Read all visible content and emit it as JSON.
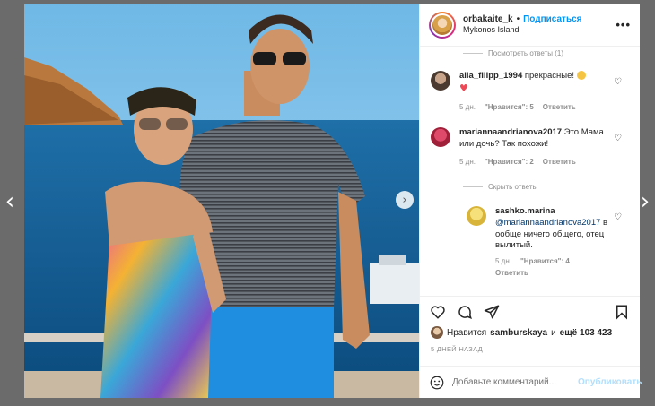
{
  "navigation": {
    "prev_glyph": "‹",
    "next_glyph": "›",
    "photo_next_glyph": "›"
  },
  "header": {
    "username": "orbakaite_k",
    "separator": "•",
    "follow_label": "Подписаться",
    "location": "Mykonos Island",
    "more_glyph": "•••"
  },
  "comments": {
    "prev_answers_label": "Посмотреть ответы (1)",
    "items": [
      {
        "user": "alla_filipp_1994",
        "text": "прекрасные!",
        "age": "5 дн.",
        "likes_label": "\"Нравится\": 5",
        "reply_label": "Ответить"
      },
      {
        "user": "mariannaandrianova2017",
        "text": "Это Мама или дочь? Так похожи!",
        "age": "5 дн.",
        "likes_label": "\"Нравится\": 2",
        "reply_label": "Ответить"
      }
    ],
    "hide_answers_label": "Скрыть ответы",
    "reply": {
      "user": "sashko.marina",
      "mention": "@mariannaandrianova2017",
      "text": "вообще ничего общего, отец вылитый.",
      "age": "5 дн.",
      "likes_label": "\"Нравится\": 4",
      "reply_label": "Ответить"
    }
  },
  "likes": {
    "prefix": "Нравится",
    "user": "samburskaya",
    "middle": "и",
    "count": "ещё 103 423"
  },
  "date": "5 ДНЕЙ НАЗАД",
  "add_comment": {
    "placeholder": "Добавьте комментарий...",
    "publish_label": "Опубликовать"
  },
  "icons": [
    "heart-icon",
    "comment-icon",
    "share-icon",
    "bookmark-icon",
    "emoji-icon",
    "chevron-left-icon",
    "chevron-right-icon"
  ],
  "colors": {
    "accent": "#0095f6",
    "publish_disabled": "#b2dffc",
    "heart": "#ed4956"
  }
}
